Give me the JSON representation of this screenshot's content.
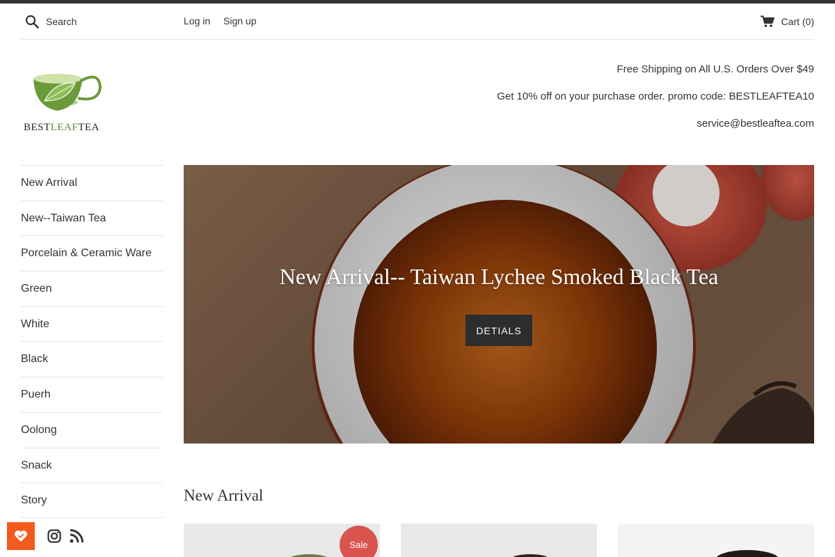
{
  "header": {
    "search_placeholder": "Search",
    "login_label": "Log in",
    "signup_label": "Sign up",
    "cart_label": "Cart (0)"
  },
  "logo": {
    "part1": "BEST",
    "part2": "LEAF",
    "part3": "TEA"
  },
  "promo": {
    "line1": "Free Shipping on All U.S. Orders Over $49",
    "line2": "Get 10% off on your purchase order. promo code: BESTLEAFTEA10",
    "line3": "service@bestleaftea.com"
  },
  "sidebar": {
    "items": [
      {
        "label": "New Arrival"
      },
      {
        "label": "New--Taiwan Tea"
      },
      {
        "label": "Porcelain & Ceramic Ware"
      },
      {
        "label": "Green"
      },
      {
        "label": "White"
      },
      {
        "label": "Black"
      },
      {
        "label": "Puerh"
      },
      {
        "label": "Oolong"
      },
      {
        "label": "Snack"
      },
      {
        "label": "Story"
      }
    ]
  },
  "hero": {
    "title": "New Arrival-- Taiwan Lychee Smoked Black Tea",
    "button_label": "DETIALS"
  },
  "section": {
    "title": "New Arrival"
  },
  "products": {
    "sale_badge": "Sale"
  },
  "colors": {
    "accent": "#f25b1d",
    "logo_green": "#5e8f2e",
    "sale_red": "#d9534f",
    "button_dark": "#2d2d2d"
  },
  "icons": [
    "search-icon",
    "cart-icon",
    "instagram-icon",
    "rss-icon",
    "heart-icon"
  ]
}
